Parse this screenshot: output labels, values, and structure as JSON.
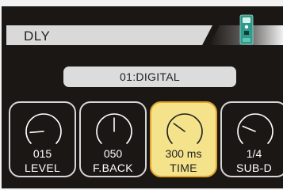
{
  "header": {
    "title": "DLY",
    "pedal_icon": "effect-pedal-icon",
    "pedal_color": "#2e9a8c"
  },
  "preset": {
    "name": "01:DIGITAL"
  },
  "knobs": [
    {
      "label": "LEVEL",
      "value": "015",
      "level": 0.15,
      "selected": false
    },
    {
      "label": "F.BACK",
      "value": "050",
      "level": 0.5,
      "selected": false
    },
    {
      "label": "TIME",
      "value": "300 ms",
      "level": 0.3,
      "selected": true
    },
    {
      "label": "SUB-D",
      "value": "1/4",
      "level": 0.25,
      "selected": false
    }
  ],
  "colors": {
    "background": "#1b1715",
    "selected_fill": "#f4e38a",
    "selected_border": "#e1a52b"
  }
}
